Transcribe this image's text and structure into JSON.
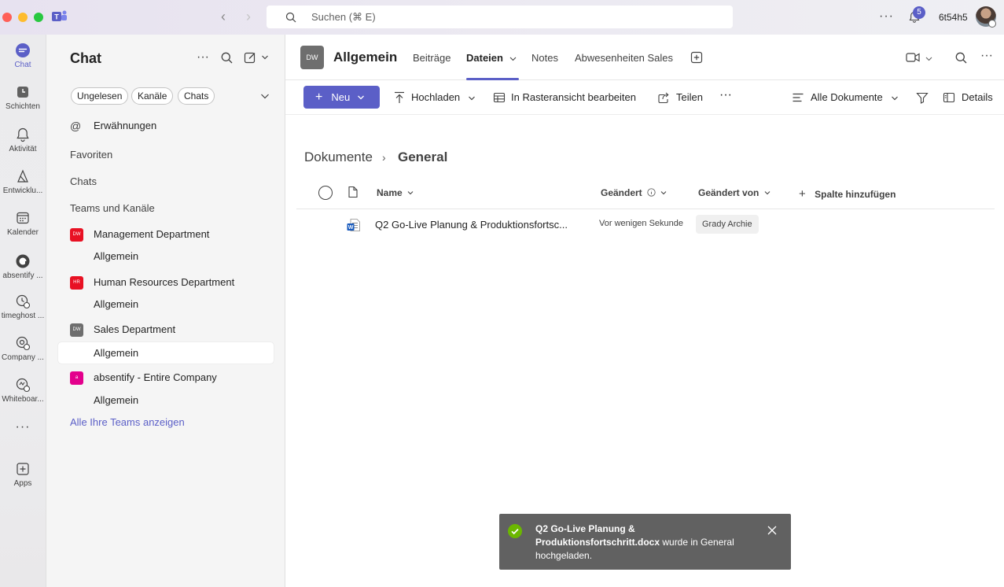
{
  "titlebar": {
    "search_placeholder": "Suchen (⌘ E)",
    "notification_count": "5",
    "username": "6t54h5"
  },
  "rail": {
    "items": [
      {
        "label": "Chat",
        "icon": "chat-icon"
      },
      {
        "label": "Schichten",
        "icon": "shifts-icon"
      },
      {
        "label": "Aktivität",
        "icon": "bell-icon"
      },
      {
        "label": "Entwicklu...",
        "icon": "developer-icon"
      },
      {
        "label": "Kalender",
        "icon": "calendar-icon"
      },
      {
        "label": "absentify ...",
        "icon": "absentify-icon"
      },
      {
        "label": "timeghost ...",
        "icon": "timeghost-icon"
      },
      {
        "label": "Company ...",
        "icon": "company-icon"
      },
      {
        "label": "Whiteboar...",
        "icon": "whiteboard-icon"
      },
      {
        "label": "Apps",
        "icon": "apps-icon"
      }
    ]
  },
  "chatpane": {
    "title": "Chat",
    "filters": [
      "Ungelesen",
      "Kanäle",
      "Chats"
    ],
    "mentions": "Erwähnungen",
    "favorites": "Favoriten",
    "chats": "Chats",
    "teams_header": "Teams und Kanäle",
    "teams": [
      {
        "name": "Management Department",
        "initials": "DW",
        "color": "#e81123",
        "channel": "Allgemein"
      },
      {
        "name": "Human Resources Department",
        "initials": "HR",
        "color": "#e81123",
        "channel": "Allgemein"
      },
      {
        "name": "Sales Department",
        "initials": "DW",
        "color": "#6e6e6e",
        "channel": "Allgemein"
      },
      {
        "name": "absentify - Entire Company",
        "initials": "a",
        "color": "#e3008c",
        "channel": "Allgemein"
      }
    ],
    "all_teams": "Alle Ihre Teams anzeigen"
  },
  "channel": {
    "avatar": "DW",
    "name": "Allgemein",
    "tabs": [
      "Beiträge",
      "Dateien",
      "Notes",
      "Abwesenheiten Sales"
    ]
  },
  "toolbar": {
    "new": "Neu",
    "upload": "Hochladen",
    "grid_edit": "In Rasteransicht bearbeiten",
    "share": "Teilen",
    "more": "···",
    "view": "Alle Dokumente",
    "details": "Details"
  },
  "breadcrumb": {
    "root": "Dokumente",
    "current": "General"
  },
  "list": {
    "columns": {
      "name": "Name",
      "modified": "Geändert",
      "modified_by": "Geändert von",
      "add_column": "Spalte hinzufügen"
    },
    "rows": [
      {
        "name": "Q2 Go-Live Planung & Produktionsfortschritt.docx",
        "display_name": "Q2 Go-Live Planung & Produktionsfortsc...",
        "modified": "Vor wenigen Sekunde",
        "modified_by": "Grady Archie"
      }
    ]
  },
  "toast": {
    "file_bold_1": "Q2 Go-Live Planung &",
    "file_bold_2": "Produktionsfortschritt.docx",
    "message_rest": " wurde in General",
    "message_end": "hochgeladen."
  },
  "colors": {
    "accent": "#5b5fc7",
    "success": "#6bb700"
  }
}
